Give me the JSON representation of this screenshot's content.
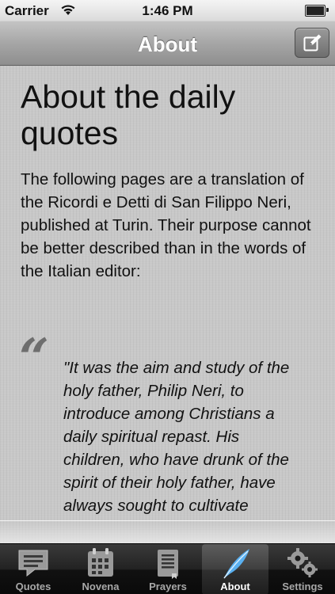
{
  "status_bar": {
    "carrier": "Carrier",
    "time": "1:46 PM"
  },
  "nav_bar": {
    "title": "About",
    "compose_icon": "compose-icon"
  },
  "content": {
    "heading": "About the daily quotes",
    "intro": "The following pages are a translation of the Ricordi e Detti di San Filippo Neri, published at Turin. Their purpose cannot be better described than in the words of the Italian editor:",
    "quote": "\"It was the aim and study of the holy father, Philip Neri, to introduce among Christians a daily spiritual repast. His children, who have drunk of the spirit of their holy father, have always sought to cultivate"
  },
  "tab_bar": {
    "tabs": [
      {
        "label": "Quotes",
        "icon": "speech-bubble-icon"
      },
      {
        "label": "Novena",
        "icon": "calendar-icon"
      },
      {
        "label": "Prayers",
        "icon": "book-icon"
      },
      {
        "label": "About",
        "icon": "quill-icon",
        "selected": true
      },
      {
        "label": "Settings",
        "icon": "gears-icon"
      }
    ]
  },
  "colors": {
    "nav_title": "#ffffff",
    "text": "#111111",
    "quote_mark": "#6e6e6e",
    "tab_selected_icon": "#5ab0f0"
  }
}
